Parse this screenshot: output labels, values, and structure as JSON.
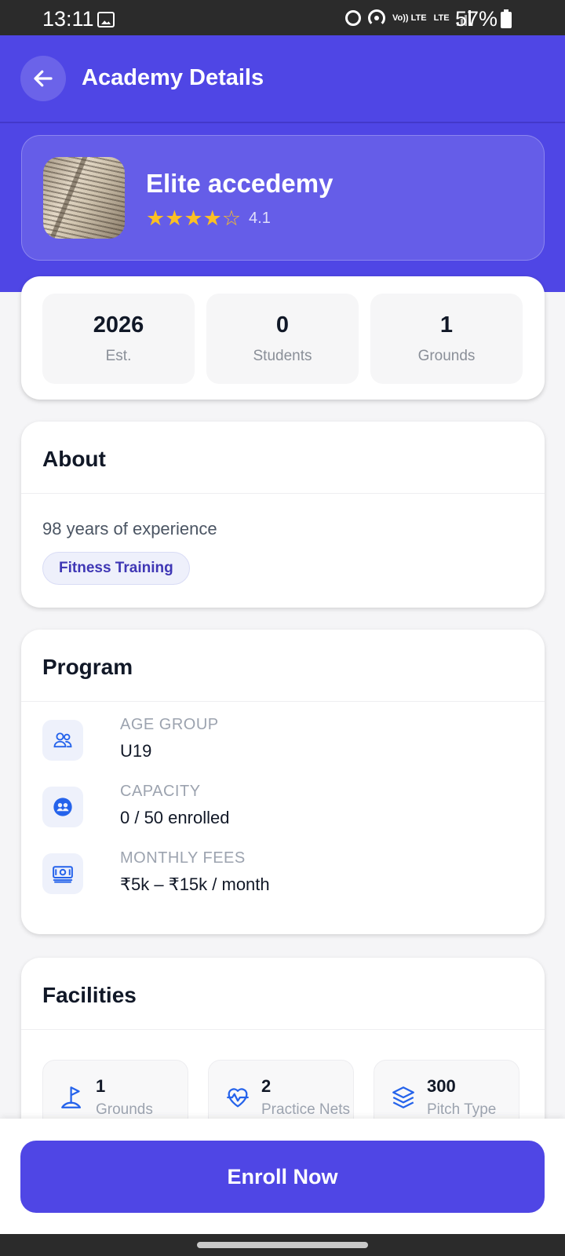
{
  "status_bar": {
    "time": "13:11",
    "battery": "57%",
    "volte": "Vo)) LTE",
    "lte": "LTE"
  },
  "header": {
    "title": "Academy Details"
  },
  "academy": {
    "name": "Elite accedemy",
    "stars": "★★★★☆",
    "rating": "4.1",
    "rating_value": 4.1
  },
  "stats": [
    {
      "value": "2026",
      "label": "Est."
    },
    {
      "value": "0",
      "label": "Students"
    },
    {
      "value": "1",
      "label": "Grounds"
    }
  ],
  "about": {
    "title": "About",
    "description": "98 years of experience",
    "tag": "Fitness Training"
  },
  "program": {
    "title": "Program",
    "rows": [
      {
        "label": "AGE GROUP",
        "value": "U19",
        "icon": "users-icon"
      },
      {
        "label": "CAPACITY",
        "value": "0 / 50 enrolled",
        "icon": "group-circle-icon"
      },
      {
        "label": "MONTHLY FEES",
        "value": "₹5k – ₹15k / month",
        "icon": "banknote-icon"
      }
    ]
  },
  "facilities": {
    "title": "Facilities",
    "items": [
      {
        "value": "1",
        "label": "Grounds",
        "icon": "flag-icon"
      },
      {
        "value": "2",
        "label": "Practice Nets",
        "icon": "heart-pulse-icon"
      },
      {
        "value": "300",
        "label": "Pitch Type",
        "icon": "layers-icon"
      }
    ]
  },
  "cta": {
    "enroll_label": "Enroll Now"
  },
  "colors": {
    "primary": "#4f46e5",
    "star": "#fbbf24",
    "icon_blue": "#2563eb"
  }
}
